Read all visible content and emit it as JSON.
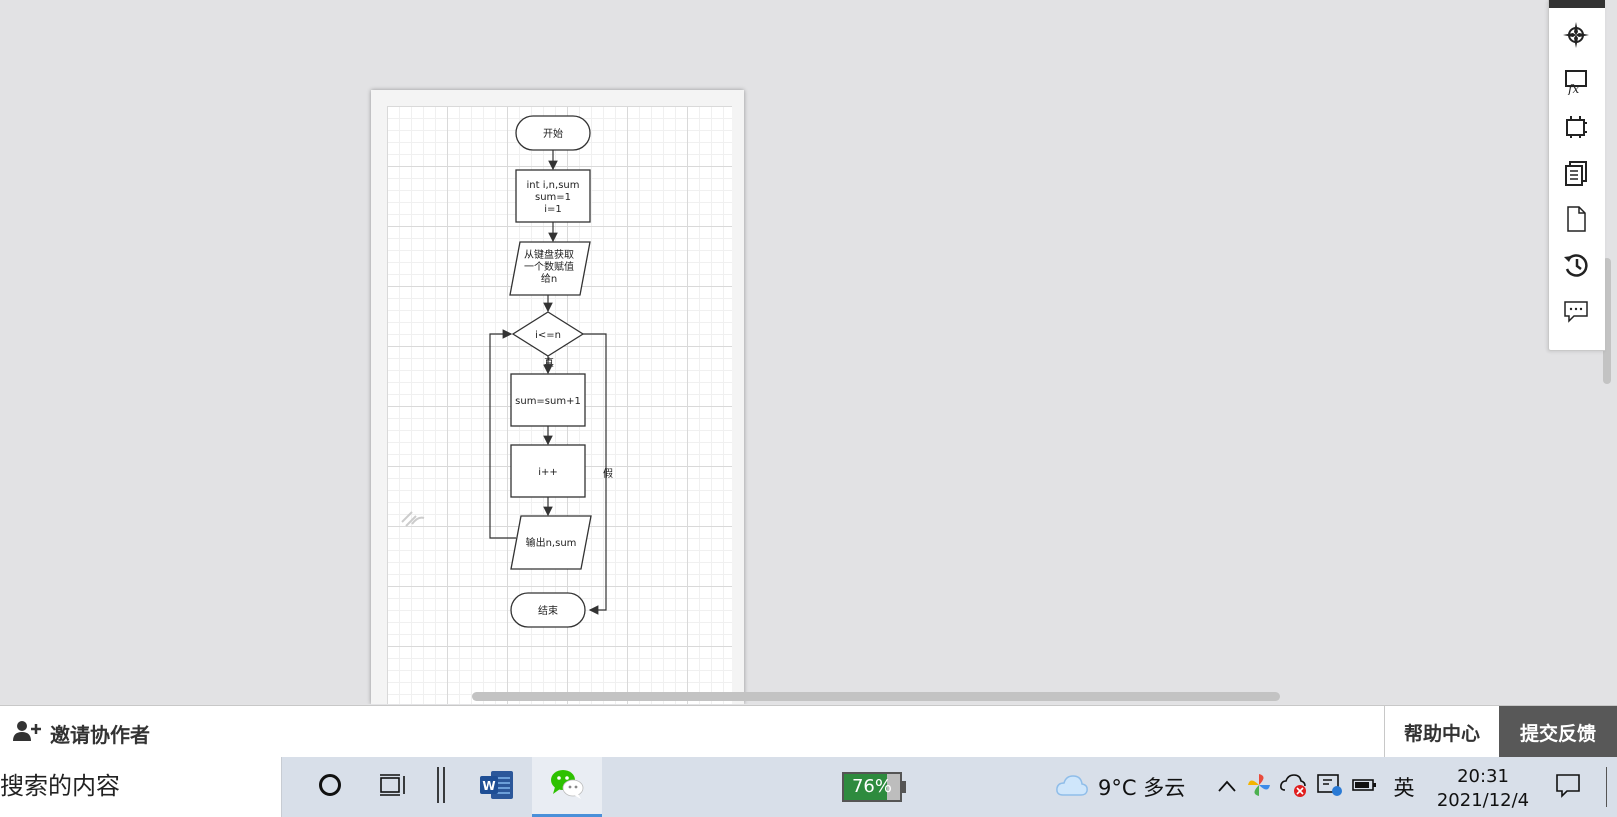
{
  "flowchart": {
    "start": "开始",
    "init": [
      "int i,n,sum",
      "sum=1",
      "i=1"
    ],
    "input": [
      "从键盘获取",
      "一个数赋值",
      "给n"
    ],
    "condition": "i<=n",
    "true_label": "真",
    "false_label": "假",
    "body": "sum=sum+1",
    "increment": "i++",
    "output": "输出n,sum",
    "end": "结束"
  },
  "footer": {
    "invite": "邀请协作者",
    "help": "帮助中心",
    "feedback": "提交反馈"
  },
  "taskbar": {
    "search_placeholder": "搜索的内容",
    "battery": "76%",
    "weather": "9°C  多云",
    "ime": "英",
    "time": "20:31",
    "date": "2021/12/4"
  },
  "colors": {
    "feedback_bg": "#585858",
    "battery_fill": "#2e8b3e",
    "wechat": "#2dc100",
    "word": "#2b579a"
  }
}
